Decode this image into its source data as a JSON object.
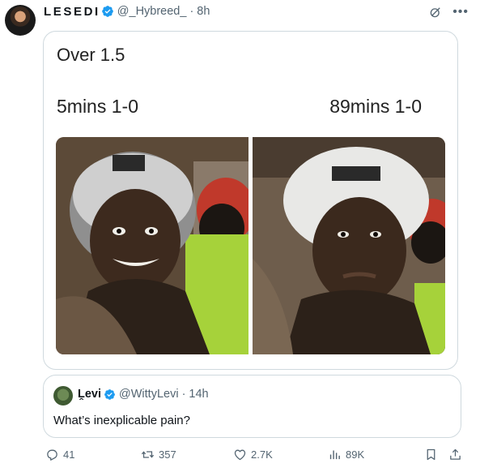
{
  "tweet": {
    "display_name": "LESEDI",
    "handle": "@_Hybreed_",
    "separator": "·",
    "time": "8h"
  },
  "post": {
    "title": "Over 1.5",
    "label_left": "5mins 1-0",
    "label_right": "89mins 1-0"
  },
  "quote": {
    "name": "Ḽevi",
    "handle": "@WittyLevi",
    "separator": "·",
    "time": "14h",
    "text": "What’s inexplicable pain?"
  },
  "actions": {
    "replies": "41",
    "reposts": "357",
    "likes": "2.7K",
    "views": "89K"
  },
  "icons": [
    "verified-badge-icon",
    "grok-icon",
    "more-icon",
    "reply-icon",
    "repost-icon",
    "like-icon",
    "views-icon",
    "bookmark-icon",
    "share-icon"
  ],
  "colors": {
    "verified": "#1d9bf0",
    "muted": "#536471",
    "border": "#cfd9de"
  }
}
